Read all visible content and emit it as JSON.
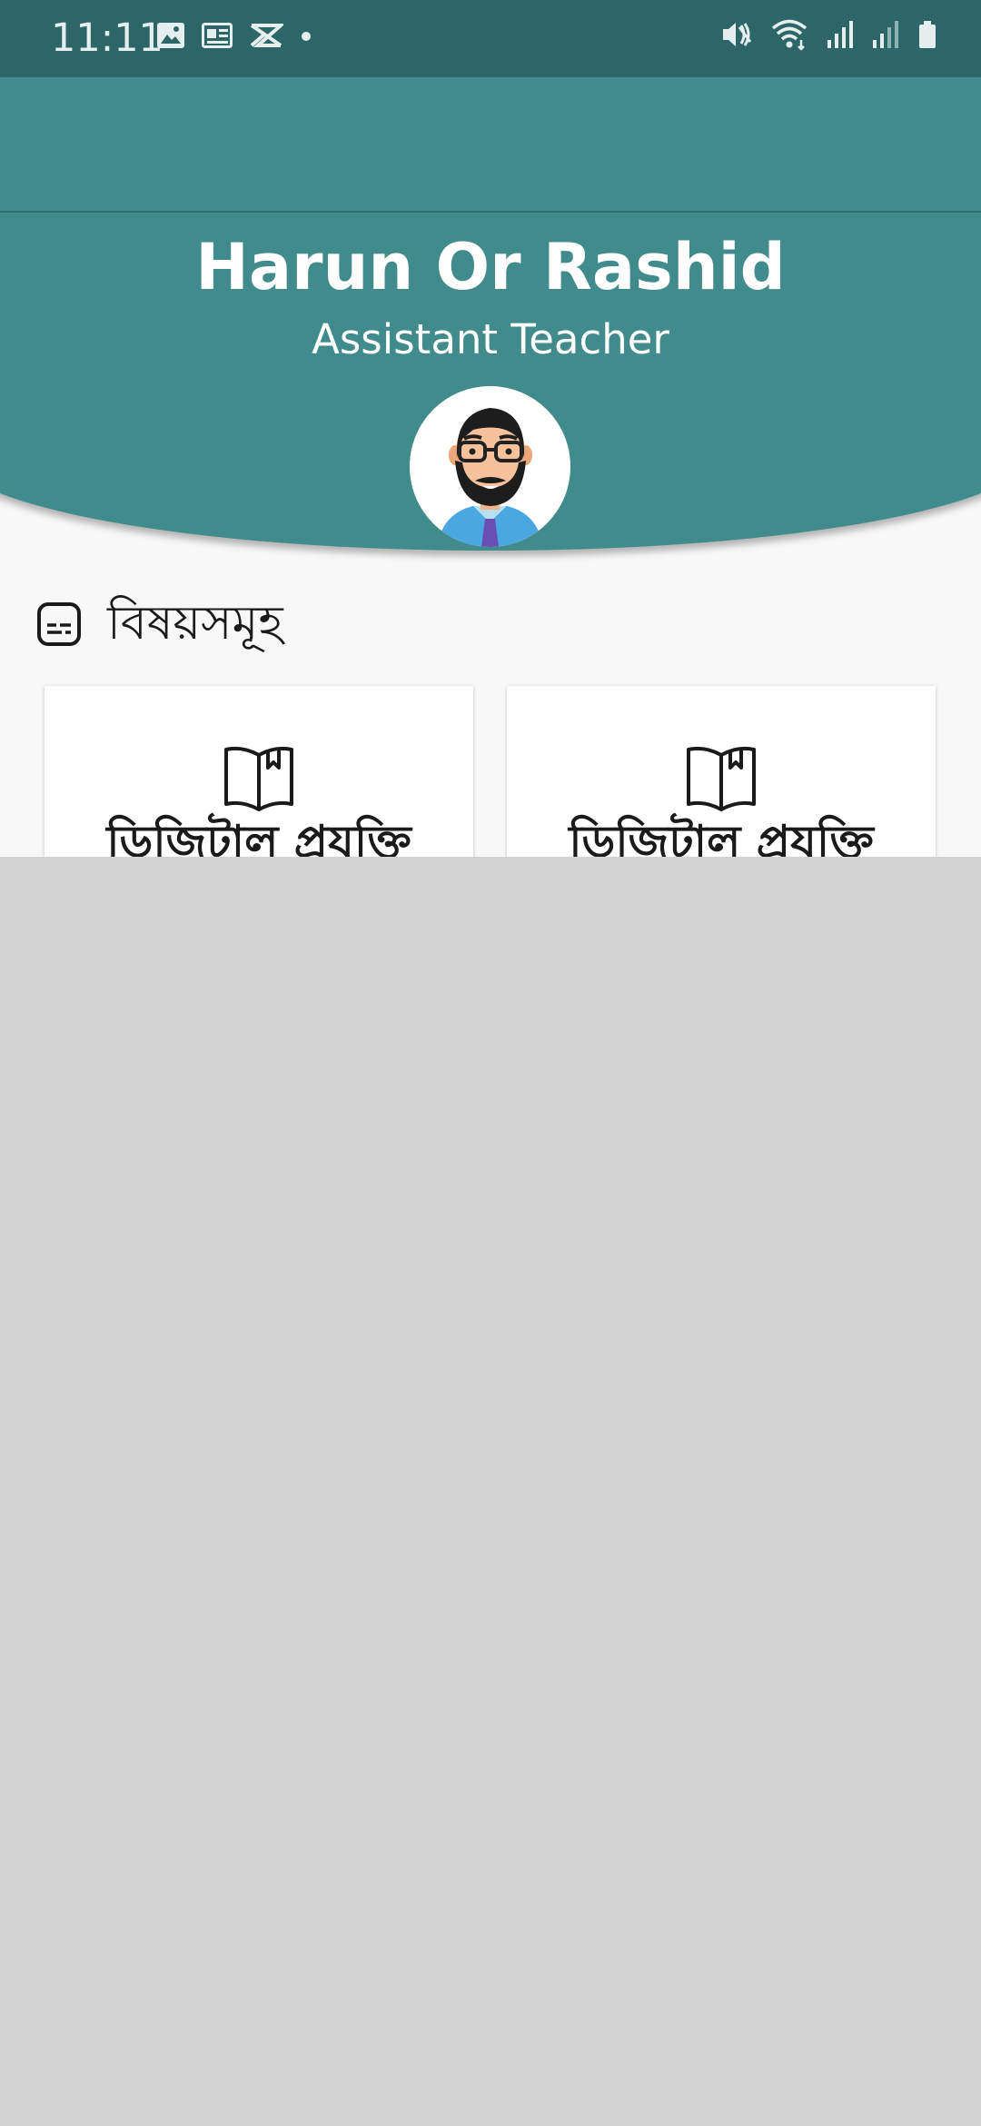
{
  "status_bar": {
    "time": "11:11",
    "left_icons": [
      "image-icon",
      "news-icon",
      "capcut-icon",
      "dot-icon"
    ],
    "right_icons": [
      "mute-icon",
      "wifi-icon",
      "signal-icon",
      "signal-icon",
      "battery-icon"
    ]
  },
  "profile": {
    "name": "Harun Or Rashid",
    "role": "Assistant Teacher",
    "avatar_icon": "teacher-avatar"
  },
  "subjects": {
    "title": "বিষয়সমূহ",
    "icon": "subtitles-icon",
    "cards": [
      {
        "title": "ডিজিটাল প্রযুক্তি",
        "icon": "book-icon"
      },
      {
        "title": "ডিজিটাল প্রযুক্তি",
        "icon": "book-icon"
      }
    ]
  },
  "colors": {
    "status_bar": "#2c6668",
    "header": "#418b8c",
    "background": "#f8f8f8",
    "overlay": "#d3d3d3"
  }
}
